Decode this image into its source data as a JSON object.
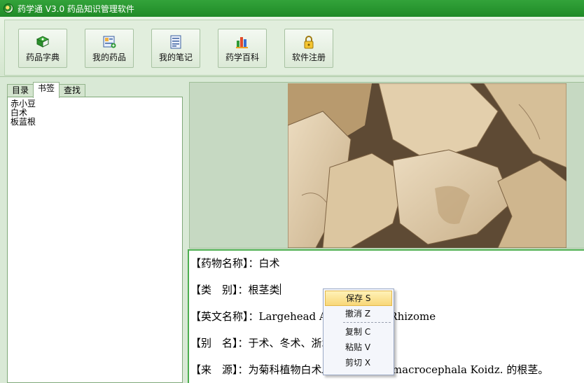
{
  "window": {
    "title": "药学通 V3.0 药品知识管理软件"
  },
  "toolbar": {
    "buttons": [
      {
        "label": "药品字典",
        "icon": "book-icon"
      },
      {
        "label": "我的药品",
        "icon": "drug-card-icon"
      },
      {
        "label": "我的笔记",
        "icon": "note-icon"
      },
      {
        "label": "药学百科",
        "icon": "encyclopedia-icon"
      },
      {
        "label": "软件注册",
        "icon": "lock-icon"
      }
    ]
  },
  "sidebar": {
    "tabs": [
      "目录",
      "书签",
      "查找"
    ],
    "active_tab": "书签",
    "items": [
      "赤小豆",
      "白术",
      "板蓝根"
    ]
  },
  "detail": {
    "lines": [
      {
        "label": "【药物名称】：",
        "value": "白术"
      },
      {
        "label": "【类　别】：",
        "value": "根茎类"
      },
      {
        "label": "【英文名称】：",
        "value": "Largehead Atractylodes Rhizome"
      },
      {
        "label": "【别　名】：",
        "value": "于术、冬术、浙术"
      },
      {
        "label": "【来　源】：",
        "value": "为菊科植物白术Atractylodes macrocephala Koidz. 的根茎。"
      }
    ]
  },
  "context_menu": {
    "items": [
      {
        "label": "保存 S",
        "highlighted": true
      },
      {
        "label": "撤消 Z",
        "highlighted": false
      },
      {
        "label": "复制 C",
        "highlighted": false
      },
      {
        "label": "粘贴 V",
        "highlighted": false
      },
      {
        "label": "剪切 X",
        "highlighted": false
      }
    ]
  },
  "colors": {
    "accent": "#2a9a32",
    "panel": "#d9e9d6",
    "menu_highlight": "#f8d778"
  }
}
